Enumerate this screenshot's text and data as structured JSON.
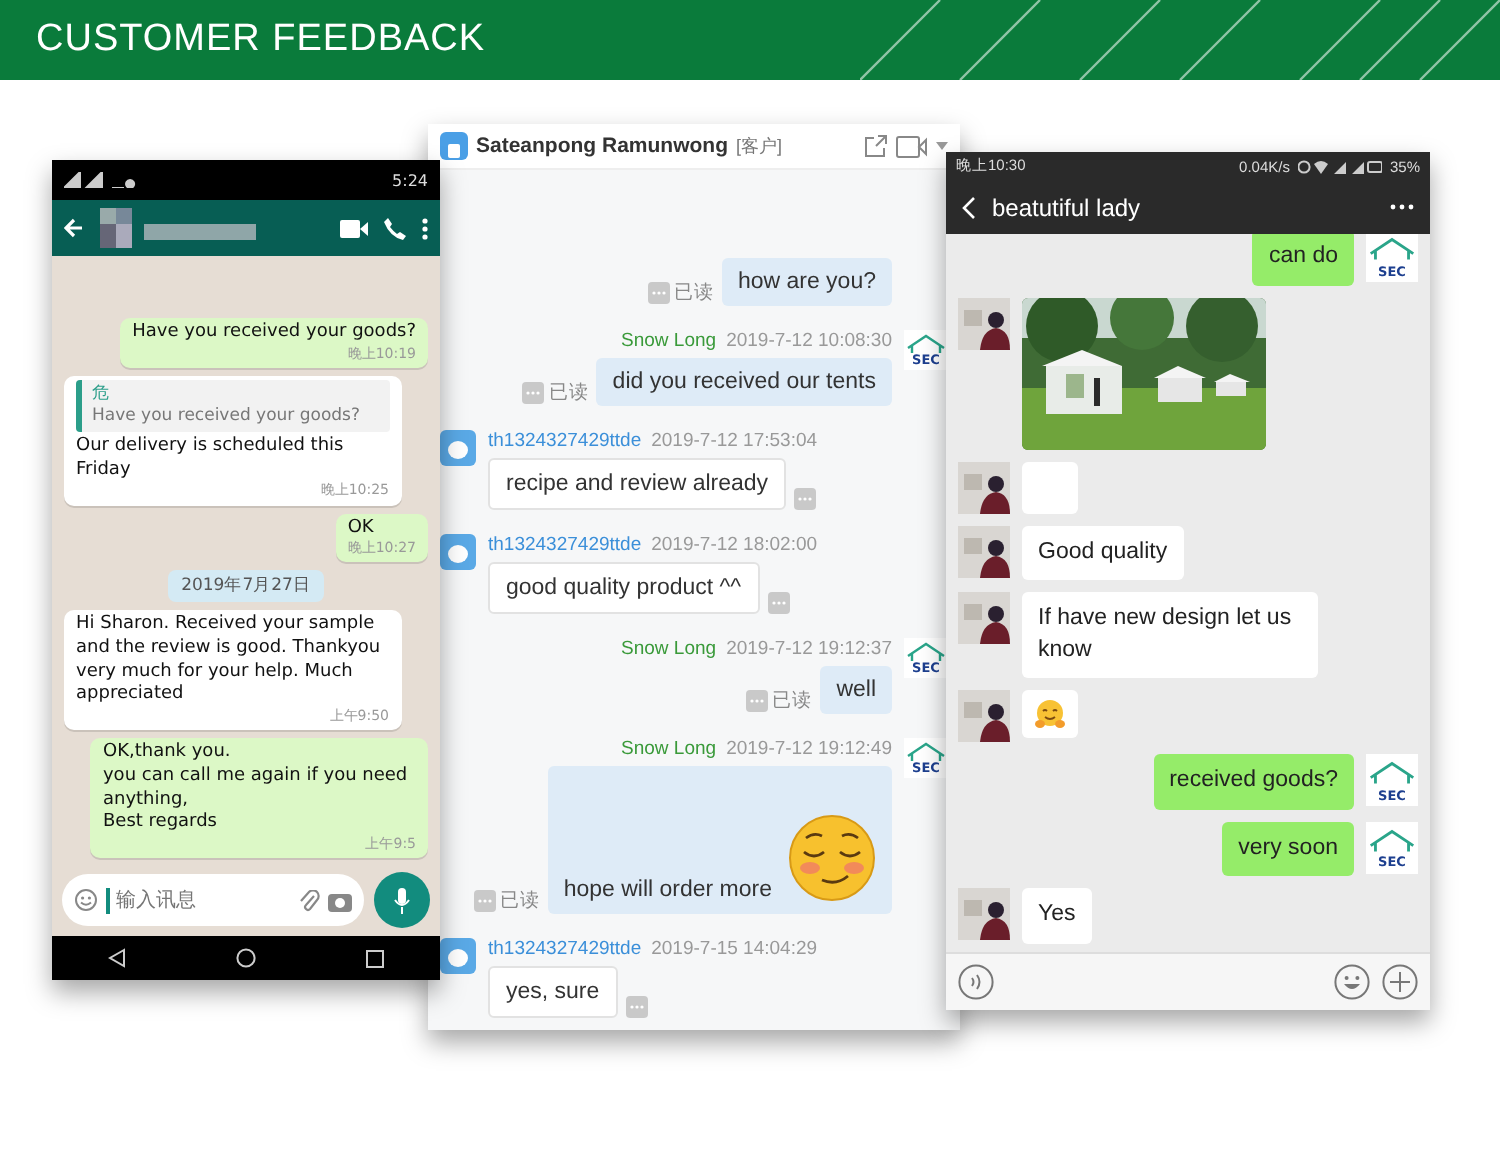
{
  "banner": {
    "title": "CUSTOMER FEEDBACK"
  },
  "whatsapp": {
    "status_time": "5:24",
    "input_placeholder": "输入讯息",
    "messages": [
      {
        "kind": "out",
        "text": "Have you received your goods?",
        "time": "晚上10:19"
      },
      {
        "kind": "in-quote",
        "quote_author": "危",
        "quote": "Have you received your goods?",
        "text": "Our delivery is scheduled this Friday",
        "time": "晚上10:25"
      },
      {
        "kind": "out",
        "text": "OK",
        "time": "晚上10:27"
      },
      {
        "kind": "date",
        "text": "2019年7月27日"
      },
      {
        "kind": "in",
        "text": "Hi Sharon. Received your sample and the review is good. Thankyou very much for your help. Much appreciated",
        "time": "上午9:50"
      },
      {
        "kind": "out",
        "text": "OK,thank you.\n you can call me again if you need anything,\nBest regards",
        "time": "上午9:5"
      }
    ]
  },
  "qq": {
    "contact": "Sateanpong Ramunwong",
    "contact_tag": "[客户]",
    "messages": [
      {
        "kind": "out-plain",
        "text": "how are you?",
        "read": "已读"
      },
      {
        "kind": "out",
        "sender": "Snow Long",
        "time": "2019-7-12 10:08:30",
        "text": "did you received our tents",
        "read": "已读",
        "avatar_text": "SEC"
      },
      {
        "kind": "in",
        "sender": "th1324327429ttde",
        "time": "2019-7-12 17:53:04",
        "text": "recipe and review already"
      },
      {
        "kind": "in",
        "sender": "th1324327429ttde",
        "time": "2019-7-12 18:02:00",
        "text": "good quality product ^^"
      },
      {
        "kind": "out",
        "sender": "Snow Long",
        "time": "2019-7-12 19:12:37",
        "text": "well",
        "read": "已读",
        "avatar_text": "SEC"
      },
      {
        "kind": "out-emoji",
        "sender": "Snow Long",
        "time": "2019-7-12 19:12:49",
        "text": "hope will order more",
        "read": "已读",
        "avatar_text": "SEC"
      },
      {
        "kind": "in",
        "sender": "th1324327429ttde",
        "time": "2019-7-15 14:04:29",
        "text": "yes, sure"
      }
    ]
  },
  "wechat": {
    "status_time": "晚上10:30",
    "status_speed": "0.04K/s",
    "battery": "35%",
    "title": "beatutiful lady",
    "messages": [
      {
        "kind": "out",
        "text": "can do",
        "avatar_text": "SEC"
      },
      {
        "kind": "in-picture"
      },
      {
        "kind": "in-blank"
      },
      {
        "kind": "in",
        "text": "Good quality"
      },
      {
        "kind": "in",
        "text": "If have new design let us know"
      },
      {
        "kind": "in-emoji"
      },
      {
        "kind": "out",
        "text": "received goods?",
        "avatar_text": "SEC"
      },
      {
        "kind": "out",
        "text": "very soon",
        "avatar_text": "SEC"
      },
      {
        "kind": "in",
        "text": "Yes"
      }
    ]
  }
}
